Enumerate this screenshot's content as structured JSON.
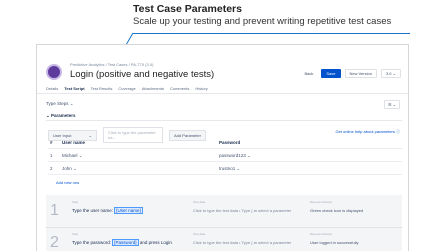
{
  "callout": {
    "title": "Test Case Parameters",
    "subtitle": "Scale up your testing and prevent writing repetitive test cases"
  },
  "header": {
    "breadcrumb": "Predictive Analytics / Test Cases / PA-T70 (3.0)",
    "title": "Login (positive and negative tests)",
    "back_label": "Back",
    "save_label": "Save",
    "new_version_label": "New Version",
    "version_select": "3.0 ⌄"
  },
  "tabs": [
    "Details",
    "Test Script",
    "Test Results",
    "Coverage",
    "Attachments",
    "Comments",
    "History"
  ],
  "active_tab": "Test Script",
  "script": {
    "type_label": "Type",
    "type_value": "Steps ⌄",
    "menu_label": "☰ ⌄"
  },
  "parameters": {
    "section_label": "⌄ Parameters",
    "source_select": "User Input",
    "name_placeholder": "Click to type the parameter na...",
    "add_button": "Add Parameter",
    "help_link": "Get online help about parameters",
    "columns": [
      "#",
      "User name",
      "Password"
    ],
    "rows": [
      {
        "num": "1",
        "user": "Michael ⌄",
        "password": "password123 ⌄"
      },
      {
        "num": "2",
        "user": "John ⌄",
        "password": "trustno1 ⌄"
      }
    ],
    "add_row_label": "Add new row"
  },
  "steps": [
    {
      "num": "1",
      "step_label": "Step",
      "text_before": "Type the user name:",
      "chip": "[User name]",
      "text_after": "",
      "data_label": "Test data",
      "data": "Click to type the test data • Type { to select a parameter",
      "result_label": "Expected Result",
      "result": "Green check icon is displayed"
    },
    {
      "num": "2",
      "step_label": "Step",
      "text_before": "Type the password:",
      "chip": "[Password]",
      "text_after": "and press Login",
      "data_label": "Test data",
      "data": "Click to type the test data • Type { to select a parameter",
      "result_label": "Expected Result",
      "result": "User logged in successfully"
    }
  ],
  "colors": {
    "accent": "#0052cc",
    "callout_line": "#1a73c9",
    "project_avatar": "#5c3b9d"
  }
}
